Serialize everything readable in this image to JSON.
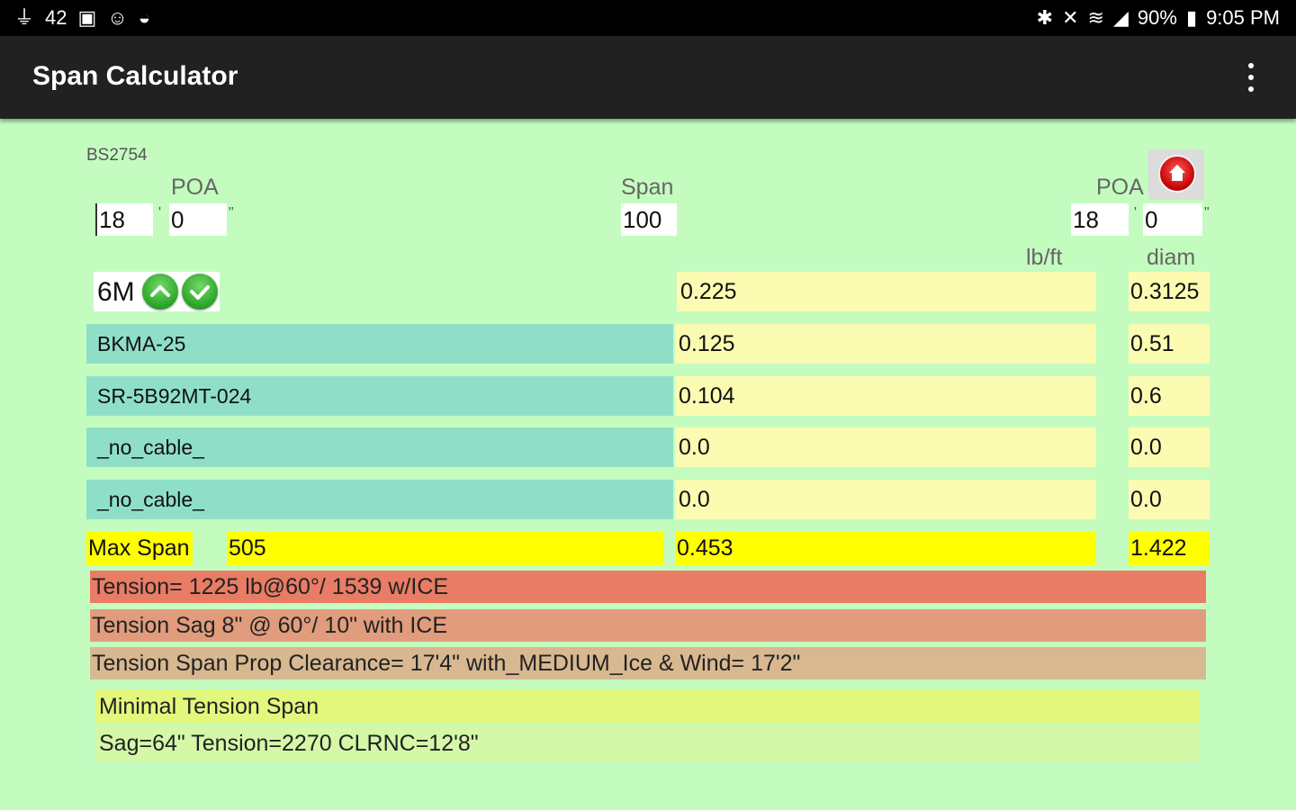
{
  "status_bar": {
    "left_temp": "42",
    "battery": "90%",
    "time": "9:05 PM"
  },
  "app_bar": {
    "title": "Span Calculator"
  },
  "form": {
    "id_label": "BS2754",
    "left_poa_label": "POA",
    "left_poa_feet": "18",
    "left_poa_inches": "0",
    "span_label": "Span",
    "span_value": "100",
    "right_poa_label": "POA",
    "right_poa_feet": "18",
    "right_poa_inches": "0",
    "lbft_header": "lb/ft",
    "diam_header": "diam"
  },
  "strand_row": {
    "name": "6M",
    "lbft": "0.225",
    "diam": "0.3125"
  },
  "cable_rows": [
    {
      "name": "BKMA-25",
      "lbft": "0.125",
      "diam": "0.51"
    },
    {
      "name": "SR-5B92MT-024",
      "lbft": "0.104",
      "diam": "0.6"
    },
    {
      "name": "_no_cable_",
      "lbft": "0.0",
      "diam": "0.0"
    },
    {
      "name": "_no_cable_",
      "lbft": "0.0",
      "diam": "0.0"
    }
  ],
  "max_span": {
    "label": "Max Span",
    "value": "505",
    "lbft_total": "0.453",
    "diam_total": "1.422"
  },
  "results": {
    "tension": "Tension= 1225 lb@60°/ 1539 w/ICE",
    "sag": "Tension Sag 8\" @ 60°/ 10\" with ICE",
    "clearance": "Tension Span Prop Clearance= 17'4\" with_MEDIUM_Ice & Wind= 17'2\"",
    "minimal_title": "Minimal Tension Span",
    "minimal_detail": "Sag=64\" Tension=2270 CLRNC=12'8\""
  },
  "colors": {
    "background": "#c4fcc0",
    "app_bar": "#212121",
    "cable_cell": "#8fdfc8",
    "value_cell": "#fbfbb2",
    "max_span": "#ffff00",
    "tension_bar": "#e87c64",
    "sag_bar": "#e09c7c",
    "clearance_bar": "#d8b890",
    "minimal_title_bar": "#e3f77c",
    "minimal_detail_bar": "#d4f8a8"
  }
}
